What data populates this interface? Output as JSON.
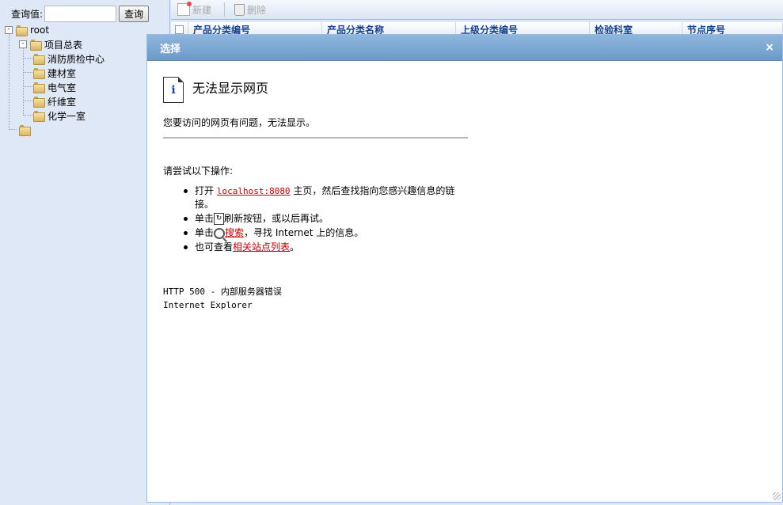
{
  "left_panel": {
    "search_label": "查询值:",
    "search_value": "",
    "search_button": "查询",
    "tree": {
      "root_label": "root",
      "group_label": "项目总表",
      "children": [
        "消防质检中心",
        "建材室",
        "电气室",
        "纤维室",
        "化学一室"
      ],
      "toggle_symbol": "-"
    }
  },
  "toolbar": {
    "new_label": "新建",
    "delete_label": "删除"
  },
  "grid": {
    "columns": [
      "产品分类编号",
      "产品分类名称",
      "上级分类编号",
      "检验科室",
      "节点序号"
    ]
  },
  "dialog": {
    "title": "选择",
    "close_symbol": "×",
    "error_title": "无法显示网页",
    "error_subtitle": "您要访问的网页有问题，无法显示。",
    "try_text": "请尝试以下操作:",
    "bullet1_prefix": "打开",
    "bullet1_link": "localhost:8080",
    "bullet1_suffix": "主页，然后查找指向您感兴趣信息的链接。",
    "bullet2_prefix": "单击",
    "bullet2_suffix": "刷新按钮，或以后再试。",
    "bullet3_prefix": "单击",
    "bullet3_link": "搜索",
    "bullet3_suffix": "，寻找 Internet 上的信息。",
    "bullet4_prefix": "也可查看",
    "bullet4_link": "相关站点列表",
    "bullet4_suffix": "。",
    "status_line": "HTTP 500 - 内部服务器错误",
    "browser_line": "Internet Explorer"
  }
}
